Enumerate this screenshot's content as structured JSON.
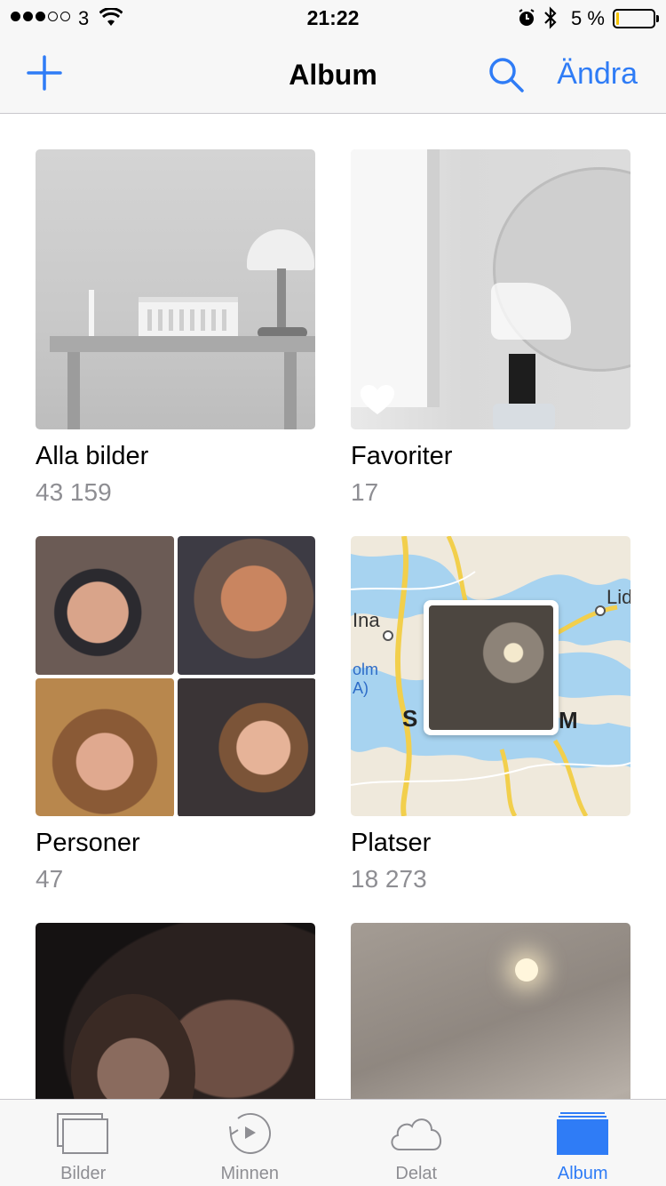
{
  "status": {
    "carrier": "3",
    "time": "21:22",
    "battery_percent": "5 %",
    "battery_level": 0.05,
    "signal_bars": 3,
    "signal_total": 5
  },
  "nav": {
    "title": "Album",
    "edit_label": "Ändra",
    "add_icon": "plus-icon",
    "search_icon": "search-icon"
  },
  "albums": [
    {
      "title": "Alla bilder",
      "count": "43 159"
    },
    {
      "title": "Favoriter",
      "count": "17"
    },
    {
      "title": "Personer",
      "count": "47"
    },
    {
      "title": "Platser",
      "count": "18 273"
    },
    {
      "title": "",
      "count": ""
    },
    {
      "title": "",
      "count": ""
    }
  ],
  "map_labels": {
    "top_right": "Lid",
    "left_mid": "Ina",
    "left_blue": "olm\nA)",
    "bold_left": "S",
    "bold_right": "M"
  },
  "tabs": [
    {
      "label": "Bilder",
      "icon": "photos-stack-icon",
      "active": false
    },
    {
      "label": "Minnen",
      "icon": "memories-icon",
      "active": false
    },
    {
      "label": "Delat",
      "icon": "cloud-icon",
      "active": false
    },
    {
      "label": "Album",
      "icon": "albums-icon",
      "active": true
    }
  ],
  "colors": {
    "accent": "#2f7cf6",
    "secondary_text": "#8e8e93",
    "bar_background": "#f7f7f7"
  }
}
